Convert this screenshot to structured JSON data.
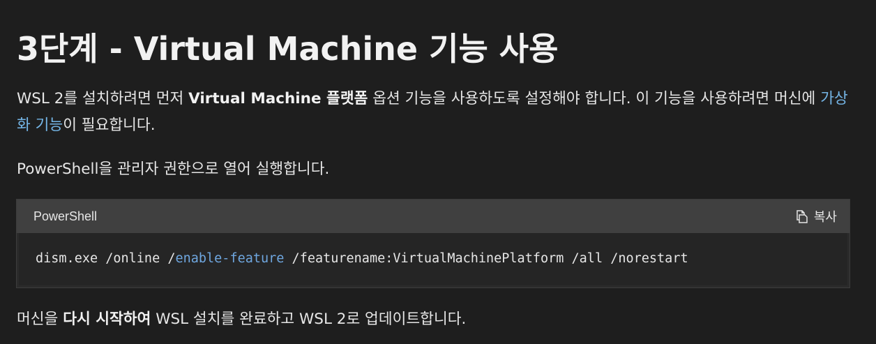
{
  "heading": "3단계 - Virtual Machine 기능 사용",
  "intro": {
    "part1": "WSL 2를 설치하려면 먼저 ",
    "bold": "Virtual Machine 플랫폼",
    "part2": " 옵션 기능을 사용하도록 설정해야 합니다. 이 기능을 사용하려면 머신에 ",
    "link": "가상화 기능",
    "part3": "이 필요합니다."
  },
  "instruction": "PowerShell을 관리자 권한으로 열어 실행합니다.",
  "code_block": {
    "language": "PowerShell",
    "copy_label": "복사",
    "copy_icon": "copy-icon",
    "command_part1": "dism.exe /online /",
    "command_keyword": "enable-feature",
    "command_part2": " /featurename:VirtualMachinePlatform /all /norestart"
  },
  "restart": {
    "part1": "머신을 ",
    "bold": "다시 시작하여",
    "part2": " WSL 설치를 완료하고 WSL 2로 업데이트합니다."
  },
  "colors": {
    "background": "#1e1e1e",
    "link": "#75b6e7",
    "code_header": "#404040",
    "code_body": "#252525"
  }
}
